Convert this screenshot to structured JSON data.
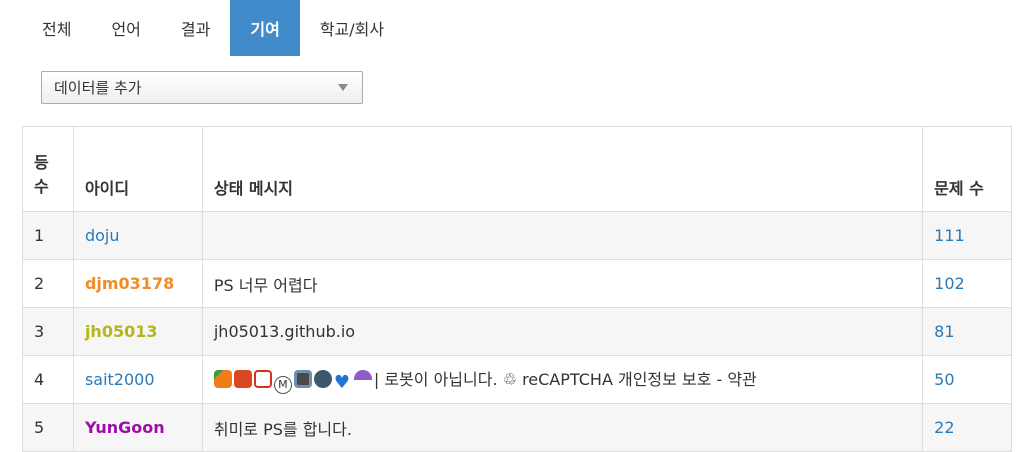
{
  "tabs": [
    {
      "label": "전체",
      "active": false
    },
    {
      "label": "언어",
      "active": false
    },
    {
      "label": "결과",
      "active": false
    },
    {
      "label": "기여",
      "active": true
    },
    {
      "label": "학교/회사",
      "active": false
    }
  ],
  "data_select": {
    "value": "데이터를 추가"
  },
  "table": {
    "headers": {
      "rank_line1": "등",
      "rank_line2": "수",
      "id": "아이디",
      "status": "상태 메시지",
      "count": "문제 수"
    },
    "rows": [
      {
        "rank": "1",
        "id": "doju",
        "id_color": "#2a7ab8",
        "id_bold": false,
        "status": "",
        "count": "111"
      },
      {
        "rank": "2",
        "id": "djm03178",
        "id_color": "#f28c28",
        "id_bold": true,
        "status": "PS 너무 어렵다",
        "count": "102"
      },
      {
        "rank": "3",
        "id": "jh05013",
        "id_color": "#b5b51d",
        "id_bold": true,
        "status": "jh05013.github.io",
        "count": "81"
      },
      {
        "rank": "4",
        "id": "sait2000",
        "id_color": "#2a7ab8",
        "id_bold": false,
        "status": "| 로봇이 아닙니다. ♲ reCAPTCHA 개인정보 보호 - 약관",
        "status_icons": [
          "carrot-icon",
          "cat-face-icon",
          "japanese-symbol-icon",
          "m-circle-icon",
          "mobile-phone-icon",
          "spiral-shell-icon",
          "blue-heart-icon",
          "umbrella-rain-icon"
        ],
        "count": "50"
      },
      {
        "rank": "5",
        "id": "YunGoon",
        "id_color": "#9b0fa6",
        "id_bold": true,
        "status": "취미로 PS를 합니다.",
        "count": "22"
      }
    ]
  },
  "colors": {
    "active_tab": "#428bca",
    "link": "#2a7ab8"
  }
}
